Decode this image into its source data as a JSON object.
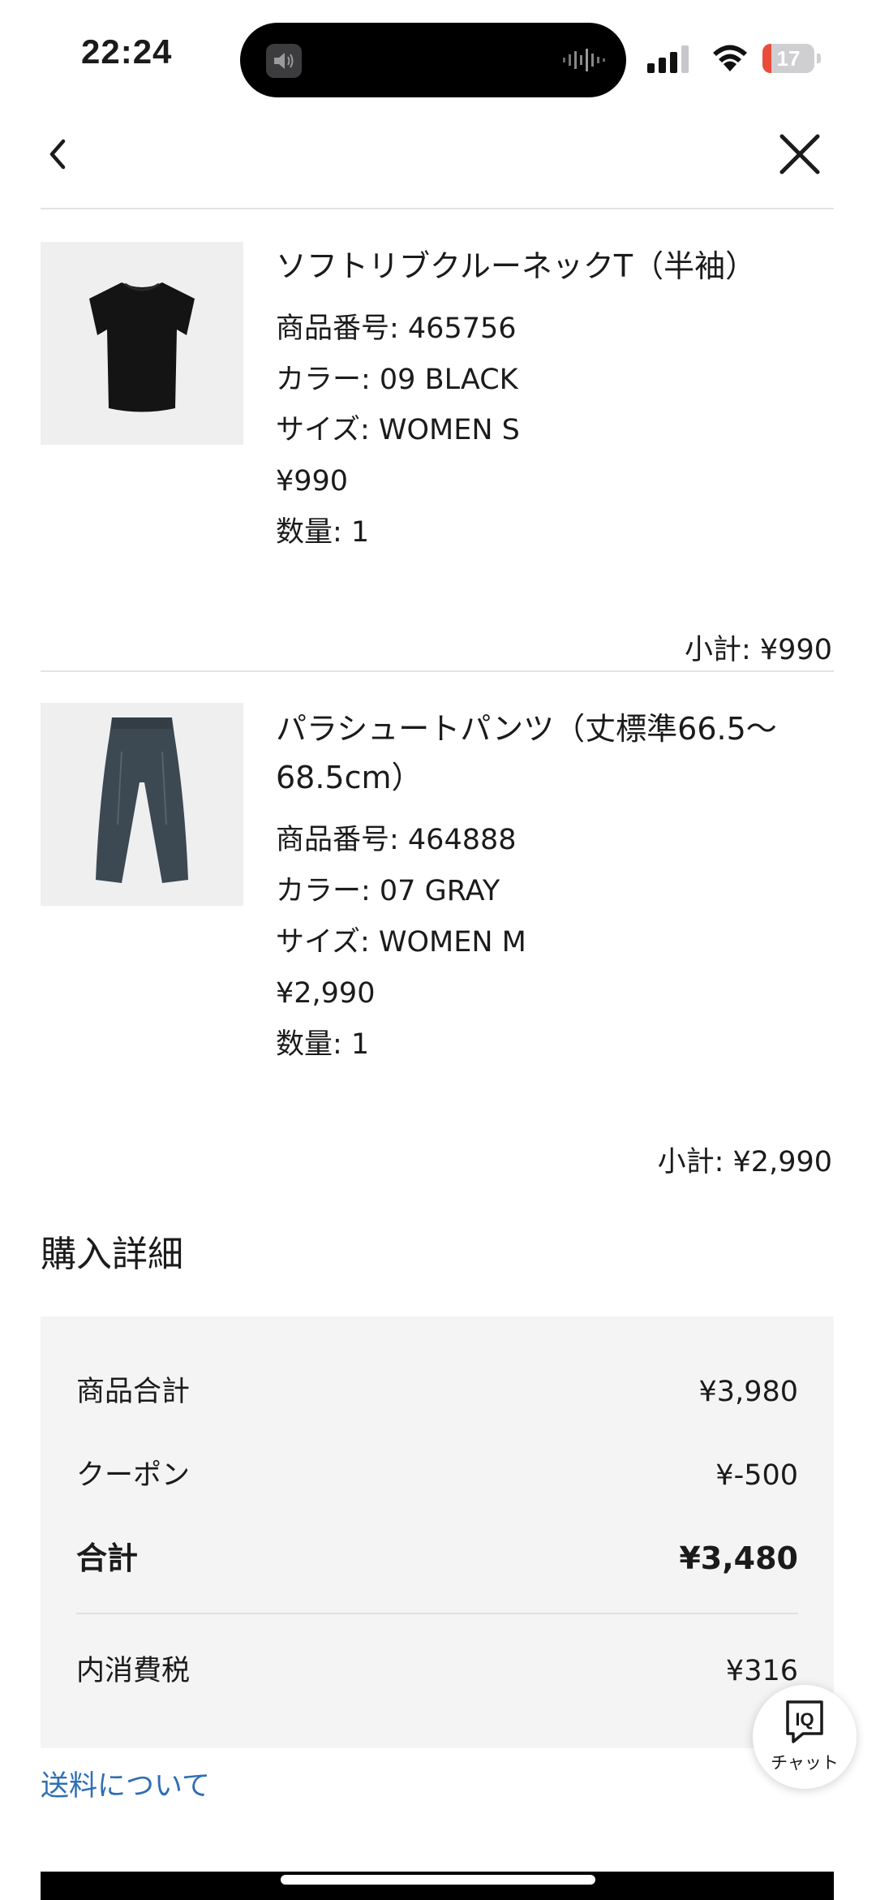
{
  "status_bar": {
    "time": "22:24",
    "battery": "17",
    "battery_fraction": 0.17,
    "battery_color": "#eb4d3d"
  },
  "nav": {
    "back_icon": "chevron-left-icon",
    "close_icon": "close-icon"
  },
  "items": [
    {
      "name": "ソフトリブクルーネックT（半袖）",
      "product_number": "商品番号: 465756",
      "color": "カラー: 09 BLACK",
      "size": "サイズ: WOMEN S",
      "price": "¥990",
      "quantity": "数量: 1",
      "subtotal": "小計: ¥990",
      "image_icon": "black-tshirt-image"
    },
    {
      "name": "パラシュートパンツ（丈標準66.5〜68.5cm）",
      "product_number": "商品番号: 464888",
      "color": "カラー: 07 GRAY",
      "size": "サイズ: WOMEN M",
      "price": "¥2,990",
      "quantity": "数量: 1",
      "subtotal": "小計: ¥2,990",
      "image_icon": "gray-pants-image"
    }
  ],
  "purchase_details": {
    "title": "購入詳細",
    "rows": [
      {
        "label": "商品合計",
        "value": "¥3,980"
      },
      {
        "label": "クーポン",
        "value": "¥-500"
      },
      {
        "label": "合計",
        "value": "¥3,480"
      },
      {
        "label": "内消費税",
        "value": "¥316"
      }
    ],
    "shipping_link": "送料について",
    "link_color": "#2f6fb3"
  },
  "chat": {
    "icon_text": "IQ",
    "label": "チャット"
  }
}
